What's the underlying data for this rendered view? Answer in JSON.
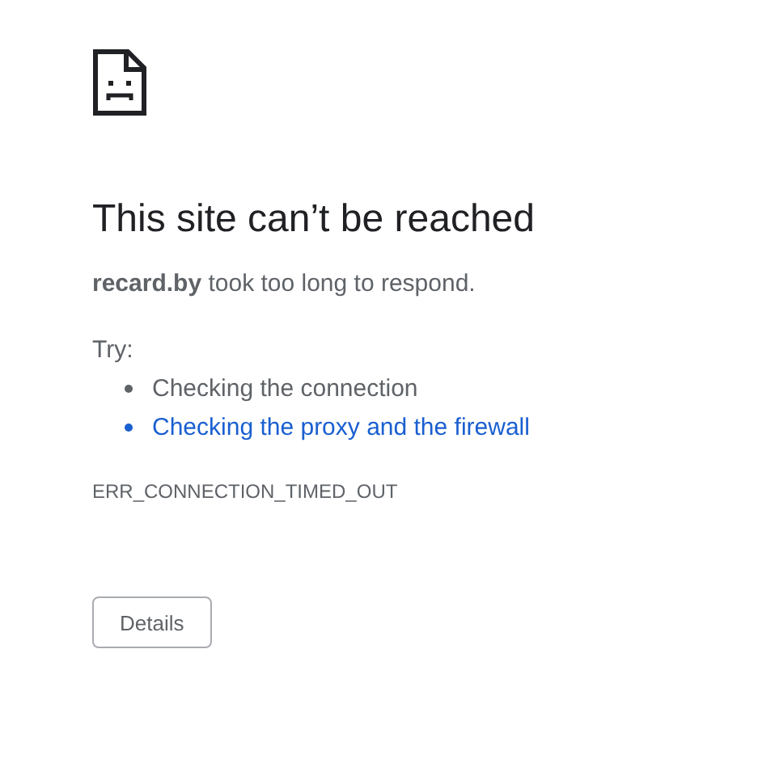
{
  "title": "This site can’t be reached",
  "message": {
    "host": "recard.by",
    "text": "took too long to respond."
  },
  "try_label": "Try:",
  "suggestions": [
    {
      "kind": "text",
      "text": "Checking the connection"
    },
    {
      "kind": "link",
      "text": "Checking the proxy and the firewall"
    }
  ],
  "error_code": "ERR_CONNECTION_TIMED_OUT",
  "button": "Details"
}
